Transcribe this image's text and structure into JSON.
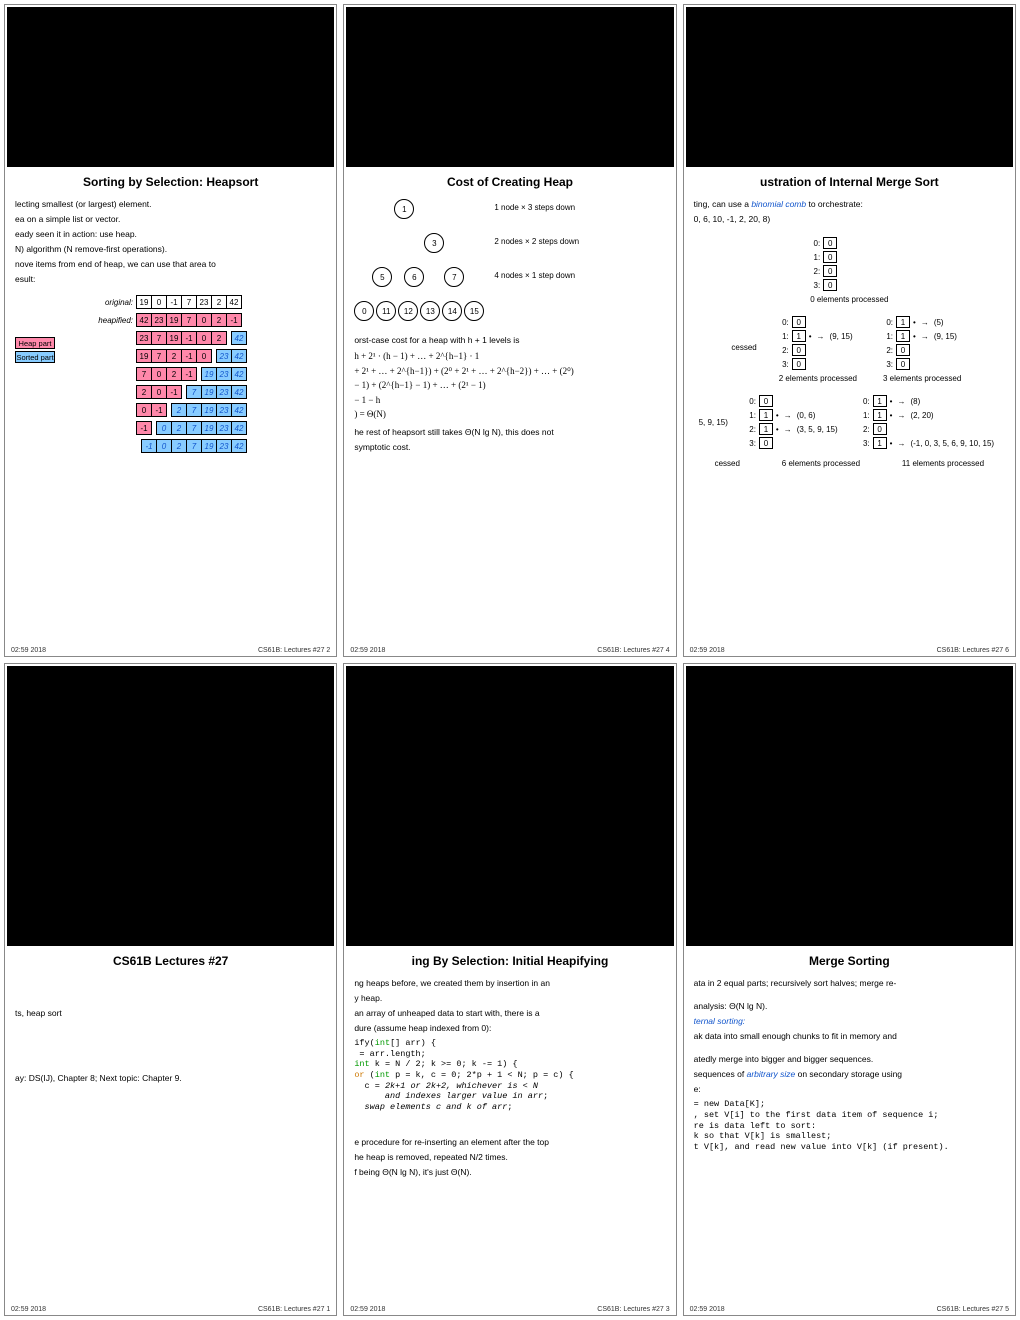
{
  "footer_date": "02:59 2018",
  "slides": {
    "s2": {
      "title": "Sorting by Selection: Heapsort",
      "lines": [
        "lecting smallest (or largest) element.",
        "ea on a simple list or vector.",
        "eady seen it in action: use heap.",
        "N) algorithm (N remove-first operations).",
        "nove items from end of heap, we can use that area to",
        "esult:"
      ],
      "labels": {
        "original": "original:",
        "heapified": "heapified:"
      },
      "arrays": {
        "original": [
          "19",
          "0",
          "-1",
          "7",
          "23",
          "2",
          "42"
        ],
        "heap1": [
          "42",
          "23",
          "19",
          "7",
          "0",
          "2",
          "-1"
        ],
        "heap2_l": [
          "23",
          "7",
          "19",
          "-1",
          "0",
          "2"
        ],
        "heap2_r": [
          "42"
        ],
        "heap3_l": [
          "19",
          "7",
          "2",
          "-1",
          "0"
        ],
        "heap3_r": [
          "23",
          "42"
        ],
        "heap4_l": [
          "7",
          "0",
          "2",
          "-1"
        ],
        "heap4_r": [
          "19",
          "23",
          "42"
        ],
        "heap5_l": [
          "2",
          "0",
          "-1"
        ],
        "heap5_r": [
          "7",
          "19",
          "23",
          "42"
        ],
        "heap6_l": [
          "0",
          "-1"
        ],
        "heap6_r": [
          "2",
          "7",
          "19",
          "23",
          "42"
        ],
        "heap7_l": [
          "-1"
        ],
        "heap7_r": [
          "0",
          "2",
          "7",
          "19",
          "23",
          "42"
        ],
        "heap8_l": [],
        "heap8_r": [
          "-1",
          "0",
          "2",
          "7",
          "19",
          "23",
          "42"
        ]
      },
      "legend": {
        "heap": "Heap part",
        "sorted": "Sorted part"
      },
      "page": "CS61B: Lectures #27  2"
    },
    "s4": {
      "title": "Cost of Creating Heap",
      "nodes": [
        "1",
        "3",
        "5",
        "6",
        "7",
        "0",
        "11",
        "12",
        "13",
        "14",
        "15"
      ],
      "tree_missing_left": "",
      "notes": [
        "1 node × 3 steps down",
        "2 nodes × 2 steps down",
        "4 nodes × 1 step down"
      ],
      "worst_intro": "orst-case cost for a heap with h + 1 levels is",
      "math": [
        "h + 2¹ · (h − 1) + … + 2^{h−1} · 1",
        "+ 2¹ + … + 2^{h−1}) + (2⁰ + 2¹ + … + 2^{h−2}) + … + (2⁰)",
        "− 1) + (2^{h−1} − 1) + … + (2¹ − 1)",
        "− 1 − h",
        ") = Θ(N)"
      ],
      "tail1": "he rest of heapsort still takes Θ(N lg N), this does not",
      "tail2": "symptotic cost.",
      "page": "CS61B: Lectures #27  4"
    },
    "s6": {
      "title": "ustration of Internal Merge Sort",
      "intro": "ting, can use a ",
      "intro_link": "binomial comb",
      "intro2": " to orchestrate:",
      "list": "0, 6, 10, -1, 2, 20, 8)",
      "stages": {
        "e0": {
          "boxes": [
            "0",
            "0",
            "0",
            "0"
          ],
          "cap": "0 elements processed"
        },
        "e2": {
          "rows": [
            [
              "0",
              ""
            ],
            [
              "1",
              "•",
              "(9, 15)"
            ],
            [
              "0",
              ""
            ],
            [
              "0",
              ""
            ]
          ],
          "left": "cessed",
          "cap": "2 elements processed"
        },
        "e3": {
          "rows": [
            [
              "1",
              "•",
              "(5)"
            ],
            [
              "1",
              "•",
              "(9, 15)"
            ],
            [
              "0",
              ""
            ],
            [
              "0",
              ""
            ]
          ],
          "cap": "3 elements processed"
        },
        "e6a": {
          "rows": [
            [
              "0",
              ""
            ],
            [
              "1",
              "•",
              "(0, 6)"
            ],
            [
              "1",
              "•",
              "(3, 5, 9, 15)"
            ],
            [
              "0",
              ""
            ]
          ],
          "note": "5, 9, 15)",
          "left": "cessed",
          "cap": "6 elements processed"
        },
        "e11": {
          "rows": [
            [
              "1",
              "•",
              "(8)"
            ],
            [
              "1",
              "•",
              "(2, 20)"
            ],
            [
              "0",
              ""
            ],
            [
              "1",
              "•",
              "(-1, 0, 3, 5, 6, 9, 10, 15)"
            ]
          ],
          "cap": "11 elements processed"
        }
      },
      "page": "CS61B: Lectures #27  6"
    },
    "s1": {
      "title": "CS61B Lectures #27",
      "lines": [
        "ts, heap sort",
        "ay: DS(IJ), Chapter 8; Next topic: Chapter 9."
      ],
      "page": "CS61B: Lectures #27  1"
    },
    "s3": {
      "title": "ing By Selection: Initial Heapifying",
      "lines": [
        "ng heaps before, we created them by insertion in an",
        "y heap.",
        "an array of unheaped data to start with, there is a",
        "dure (assume heap indexed from 0):"
      ],
      "code": [
        {
          "t": "ify",
          "c": ""
        },
        {
          "t": "(",
          "c": ""
        },
        {
          "t": "int",
          "c": "kw-int"
        },
        {
          "t": "[] arr) {\n",
          "c": ""
        },
        {
          "t": " = arr.length;\n",
          "c": ""
        },
        {
          "t": "int",
          "c": "kw-int"
        },
        {
          "t": " k = N / 2; k >= 0; k -= 1) {\n",
          "c": ""
        },
        {
          "t": "or",
          "c": "kw-for"
        },
        {
          "t": " (",
          "c": ""
        },
        {
          "t": "int",
          "c": "kw-int"
        },
        {
          "t": " p = k, c = 0; 2*p + 1 < N; p = c) {\n",
          "c": ""
        },
        {
          "t": "  c = ",
          "c": ""
        },
        {
          "t": "2k+1 or 2k+2, whichever is < N\n",
          "c": "italic"
        },
        {
          "t": "      and indexes larger value in arr",
          "c": "italic"
        },
        {
          "t": ";\n",
          "c": ""
        },
        {
          "t": "  swap elements c and k of arr",
          "c": "italic"
        },
        {
          "t": ";\n",
          "c": ""
        }
      ],
      "tail": [
        "e procedure for re-inserting an element after the top",
        "he heap is removed, repeated N/2 times.",
        "f being Θ(N lg N), it's just Θ(N)."
      ],
      "page": "CS61B: Lectures #27  3"
    },
    "s5": {
      "title": "Merge Sorting",
      "lines1": [
        "ata in 2 equal parts; recursively sort halves; merge re-",
        " analysis: Θ(N lg N)."
      ],
      "link": "ternal sorting:",
      "lines2": [
        "ak data into small enough chunks to fit in memory and",
        "atedly merge into bigger and bigger sequences.",
        " sequences of ",
        " on secondary storage using",
        "e:"
      ],
      "arbsize": "arbitrary size",
      "code": [
        "= new Data[K];",
        ", set V[i] to the first data item of sequence i;",
        "re is data left to sort:",
        "k so that V[k] is smallest;",
        "t V[k], and read new value into V[k] (if present)."
      ],
      "page": "CS61B: Lectures #27  5"
    }
  }
}
